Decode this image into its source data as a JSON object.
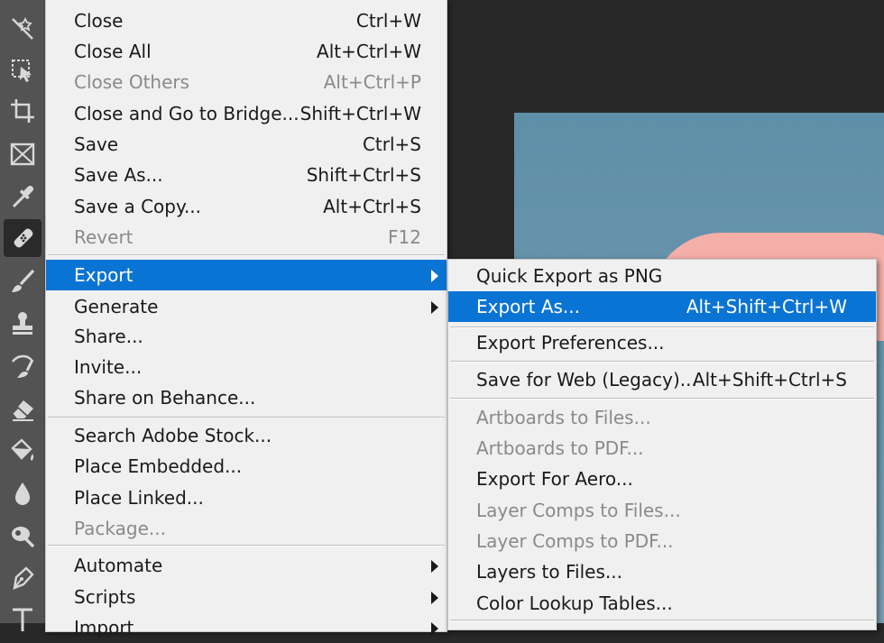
{
  "toolbar": {
    "tools": [
      {
        "icon": "magic-wand-icon"
      },
      {
        "icon": "object-selection-icon"
      },
      {
        "icon": "crop-icon"
      },
      {
        "icon": "frame-icon"
      },
      {
        "icon": "eyedropper-icon"
      },
      {
        "icon": "spot-healing-brush-icon"
      },
      {
        "icon": "brush-icon"
      },
      {
        "icon": "clone-stamp-icon"
      },
      {
        "icon": "history-brush-icon"
      },
      {
        "icon": "eraser-icon"
      },
      {
        "icon": "paint-bucket-icon"
      },
      {
        "icon": "blur-icon"
      },
      {
        "icon": "dodge-icon"
      },
      {
        "icon": "pen-icon"
      },
      {
        "icon": "type-icon"
      }
    ]
  },
  "file_menu": {
    "items": [
      {
        "label": "Close",
        "shortcut": "Ctrl+W"
      },
      {
        "label": "Close All",
        "shortcut": "Alt+Ctrl+W"
      },
      {
        "label": "Close Others",
        "shortcut": "Alt+Ctrl+P"
      },
      {
        "label": "Close and Go to Bridge...",
        "shortcut": "Shift+Ctrl+W"
      },
      {
        "label": "Save",
        "shortcut": "Ctrl+S"
      },
      {
        "label": "Save As...",
        "shortcut": "Shift+Ctrl+S"
      },
      {
        "label": "Save a Copy...",
        "shortcut": "Alt+Ctrl+S"
      },
      {
        "label": "Revert",
        "shortcut": "F12"
      },
      {
        "label": "Export"
      },
      {
        "label": "Generate"
      },
      {
        "label": "Share..."
      },
      {
        "label": "Invite..."
      },
      {
        "label": "Share on Behance..."
      },
      {
        "label": "Search Adobe Stock..."
      },
      {
        "label": "Place Embedded..."
      },
      {
        "label": "Place Linked..."
      },
      {
        "label": "Package..."
      },
      {
        "label": "Automate"
      },
      {
        "label": "Scripts"
      },
      {
        "label": "Import"
      }
    ]
  },
  "export_menu": {
    "items": [
      {
        "label": "Quick Export as PNG"
      },
      {
        "label": "Export As...",
        "shortcut": "Alt+Shift+Ctrl+W"
      },
      {
        "label": "Export Preferences..."
      },
      {
        "label": "Save for Web (Legacy)...",
        "shortcut": "Alt+Shift+Ctrl+S"
      },
      {
        "label": "Artboards to Files..."
      },
      {
        "label": "Artboards to PDF..."
      },
      {
        "label": "Export For Aero..."
      },
      {
        "label": "Layer Comps to Files..."
      },
      {
        "label": "Layer Comps to PDF..."
      },
      {
        "label": "Layers to Files..."
      },
      {
        "label": "Color Lookup Tables..."
      }
    ]
  },
  "colors": {
    "highlight": "#0a74d5",
    "menu_bg": "#f0f0f0",
    "disabled": "#8a8a8a",
    "toolbar": "#535353"
  }
}
